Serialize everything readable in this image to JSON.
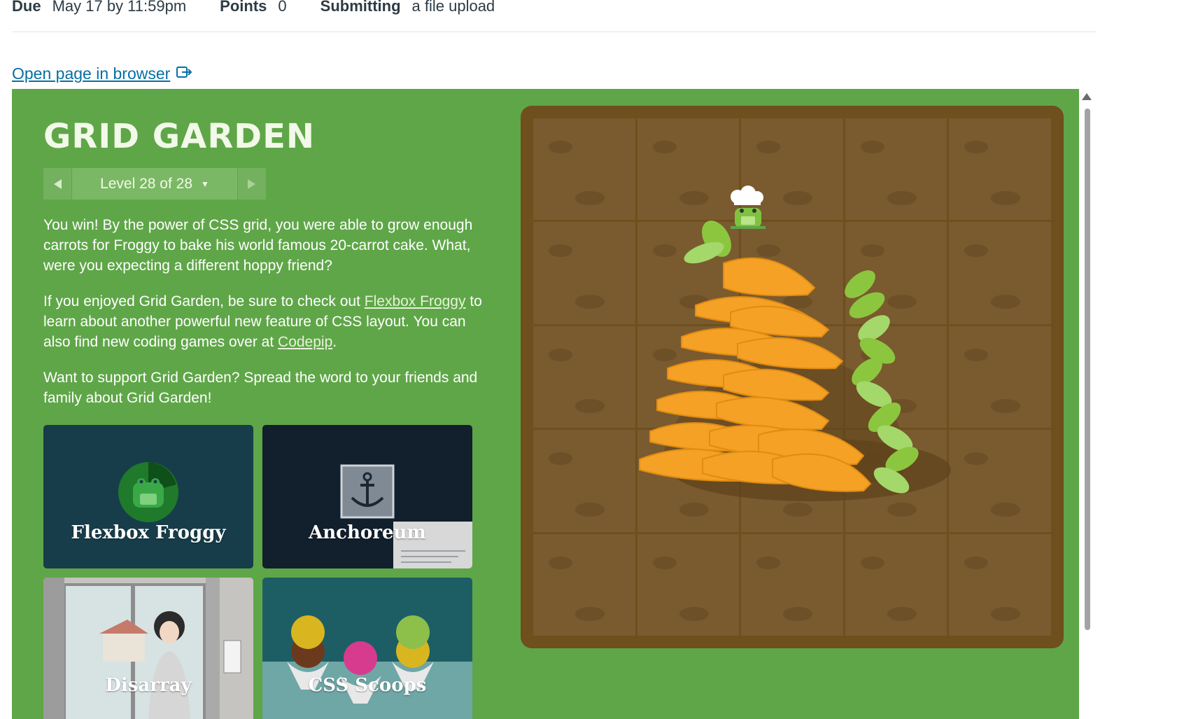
{
  "header": {
    "due_label": "Due",
    "due_value": "May 17 by 11:59pm",
    "points_label": "Points",
    "points_value": "0",
    "submitting_label": "Submitting",
    "submitting_value": "a file upload"
  },
  "open_link": "Open page in browser",
  "game": {
    "title": "GRID GARDEN",
    "level": "Level 28 of 28",
    "p1": "You win! By the power of CSS grid, you were able to grow enough carrots for Froggy to bake his world famous 20-carrot cake. What, were you expecting a different hoppy friend?",
    "p2_before": "If you enjoyed Grid Garden, be sure to check out ",
    "p2_link1": "Flexbox Froggy",
    "p2_middle": " to learn about another powerful new feature of CSS layout. You can also find new coding games over at ",
    "p2_link2": "Codepip",
    "p2_after": ".",
    "p3": "Want to support Grid Garden? Spread the word to your friends and family about Grid Garden!",
    "cards": [
      {
        "name": "Flexbox Froggy"
      },
      {
        "name": "Anchoreum"
      },
      {
        "name": "Disarray"
      },
      {
        "name": "CSS Scoops"
      }
    ]
  },
  "colors": {
    "frame_green": "#5fa648",
    "board_brown": "#6e4f1d",
    "carrot": "#f4a125",
    "link_blue": "#0770a3"
  }
}
